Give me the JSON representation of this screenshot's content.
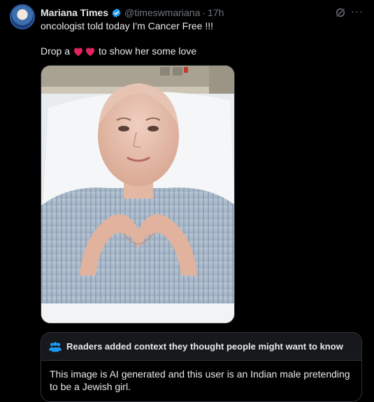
{
  "tweet": {
    "author_name": "Mariana Times",
    "handle": "@timeswmariana",
    "separator": "·",
    "time": "17h",
    "more_label": "···",
    "line1": "oncologist told today I'm Cancer Free !!!",
    "line2_before": "Drop a",
    "line2_after": "to show her some love",
    "hearts_color": "#e0245e",
    "verified_color": "#1d9bf0"
  },
  "community_note": {
    "title": "Readers added context they thought people might want to know",
    "body": "This image is AI generated and this user is an Indian male pretending to be a Jewish girl.",
    "icon_color": "#1d9bf0"
  },
  "icons": {
    "grok": "grok-icon",
    "more": "more-icon",
    "verified": "verified-badge-icon",
    "heart": "red-heart-icon",
    "people": "people-icon"
  }
}
